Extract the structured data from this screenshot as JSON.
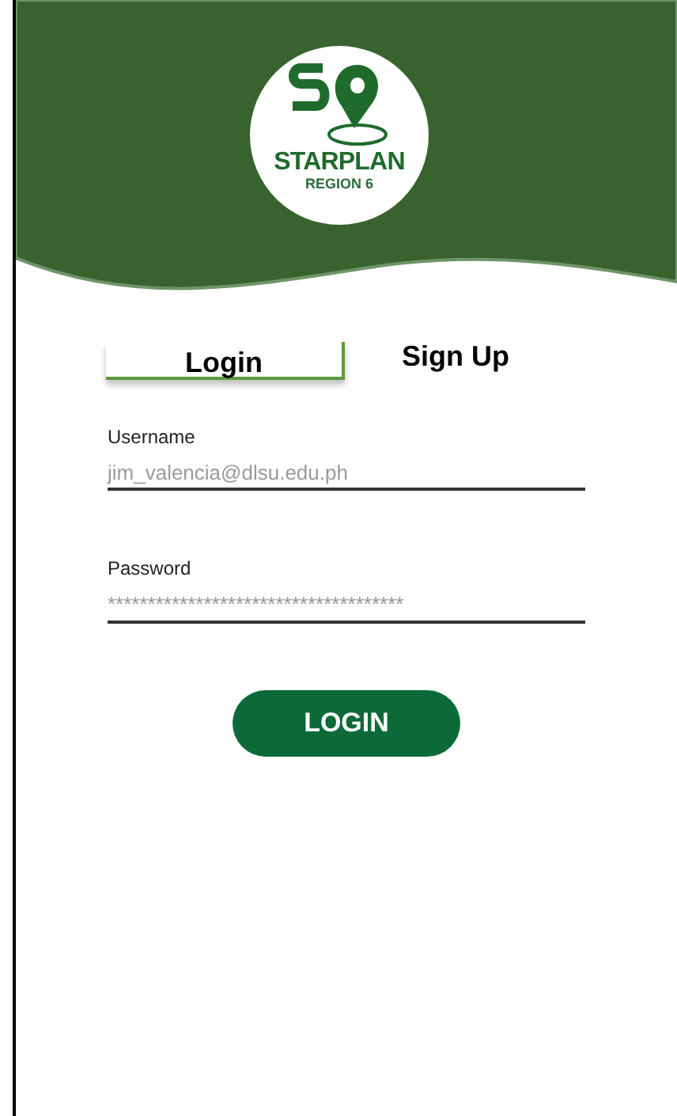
{
  "logo": {
    "title": "STARPLAN",
    "subtitle": "REGION 6"
  },
  "tabs": [
    {
      "label": "Login",
      "selected": true
    },
    {
      "label": "Sign Up",
      "selected": false
    }
  ],
  "fields": [
    {
      "label": "Username",
      "value": "jim_valencia@dlsu.edu.ph"
    },
    {
      "label": "Password",
      "value": "*************************************"
    }
  ],
  "button": "LOGIN"
}
